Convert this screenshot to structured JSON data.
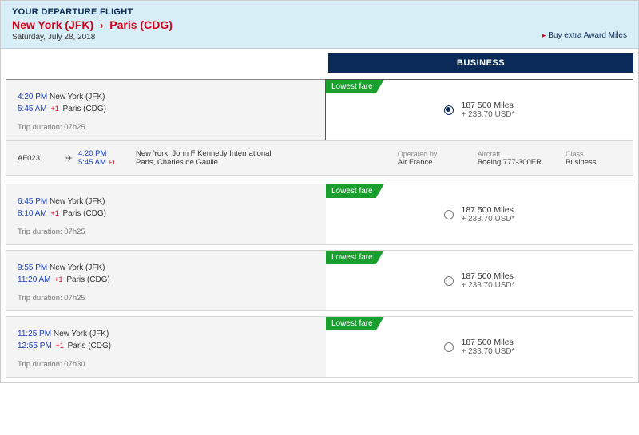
{
  "header": {
    "title": "YOUR DEPARTURE FLIGHT",
    "origin": "New York (JFK)",
    "destination": "Paris (CDG)",
    "date": "Saturday, July 28, 2018",
    "buy_miles": "Buy extra Award Miles"
  },
  "cabin": {
    "label": "BUSINESS"
  },
  "lowest_fare_label": "Lowest fare",
  "options": [
    {
      "dep_time": "4:20 PM",
      "dep_city": "New York (JFK)",
      "arr_time": "5:45 AM",
      "arr_plus": "+1",
      "arr_city": "Paris (CDG)",
      "duration": "Trip duration: 07h25",
      "miles": "187 500 Miles",
      "taxes": "+ 233.70 USD*",
      "selected": true
    },
    {
      "dep_time": "6:45 PM",
      "dep_city": "New York (JFK)",
      "arr_time": "8:10 AM",
      "arr_plus": "+1",
      "arr_city": "Paris (CDG)",
      "duration": "Trip duration: 07h25",
      "miles": "187 500 Miles",
      "taxes": "+ 233.70 USD*",
      "selected": false
    },
    {
      "dep_time": "9:55 PM",
      "dep_city": "New York (JFK)",
      "arr_time": "11:20 AM",
      "arr_plus": "+1",
      "arr_city": "Paris (CDG)",
      "duration": "Trip duration: 07h25",
      "miles": "187 500 Miles",
      "taxes": "+ 233.70 USD*",
      "selected": false
    },
    {
      "dep_time": "11:25 PM",
      "dep_city": "New York (JFK)",
      "arr_time": "12:55 PM",
      "arr_plus": "+1",
      "arr_city": "Paris (CDG)",
      "duration": "Trip duration: 07h30",
      "miles": "187 500 Miles",
      "taxes": "+ 233.70 USD*",
      "selected": false
    }
  ],
  "detail": {
    "flight_number": "AF023",
    "dep_time": "4:20 PM",
    "arr_time": "5:45 AM",
    "arr_plus": "+1",
    "dep_airport": "New York, John F Kennedy International",
    "arr_airport": "Paris, Charles de Gaulle",
    "operated_by_label": "Operated by",
    "operated_by": "Air France",
    "aircraft_label": "Aircraft",
    "aircraft": "Boeing 777-300ER",
    "class_label": "Class",
    "class": "Business"
  }
}
